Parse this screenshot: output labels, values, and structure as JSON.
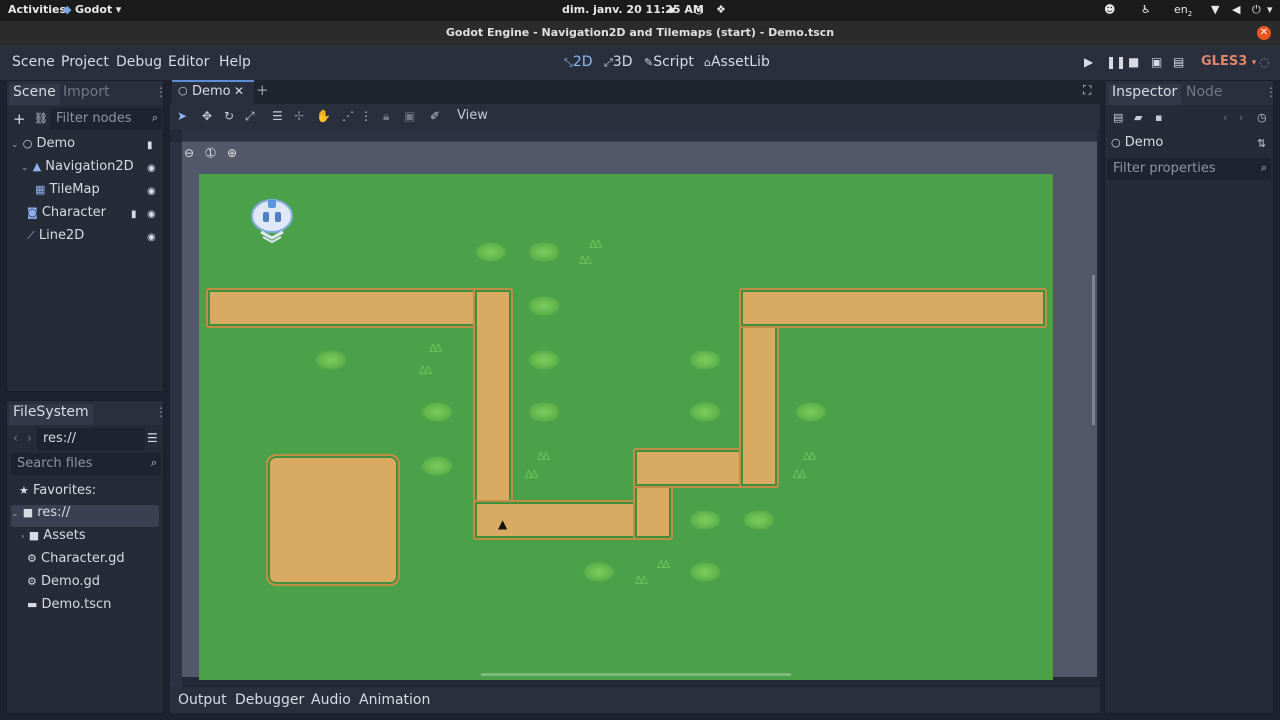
{
  "system_bar": {
    "activities": "Activities",
    "app": "Godot",
    "datetime": "dim. janv. 20  11:25 AM",
    "keyboard": "en",
    "keyboard_sub": "2"
  },
  "window": {
    "title": "Godot Engine - Navigation2D and Tilemaps (start) - Demo.tscn"
  },
  "menu": {
    "items": [
      "Scene",
      "Project",
      "Debug",
      "Editor",
      "Help"
    ],
    "workspaces": [
      "2D",
      "3D",
      "Script",
      "AssetLib"
    ],
    "renderer": "GLES3"
  },
  "scene_dock": {
    "tabs": [
      "Scene",
      "Import"
    ],
    "filter_placeholder": "Filter nodes",
    "nodes": [
      "Demo",
      "Navigation2D",
      "TileMap",
      "Character",
      "Line2D"
    ]
  },
  "filesystem_dock": {
    "title": "FileSystem",
    "path": "res://",
    "search_placeholder": "Search files",
    "favorites": "Favorites:",
    "root": "res://",
    "items": [
      "Assets",
      "Character.gd",
      "Demo.gd",
      "Demo.tscn"
    ]
  },
  "editor": {
    "tab": "Demo",
    "view_menu": "View"
  },
  "bottom_tabs": [
    "Output",
    "Debugger",
    "Audio",
    "Animation"
  ],
  "inspector": {
    "tabs": [
      "Inspector",
      "Node"
    ],
    "object": "Demo",
    "filter_placeholder": "Filter properties"
  },
  "colors": {
    "accent": "#5c8fd6",
    "grass": "#4ba04a",
    "path": "#d8aa62",
    "renderer": "#e0866c"
  }
}
